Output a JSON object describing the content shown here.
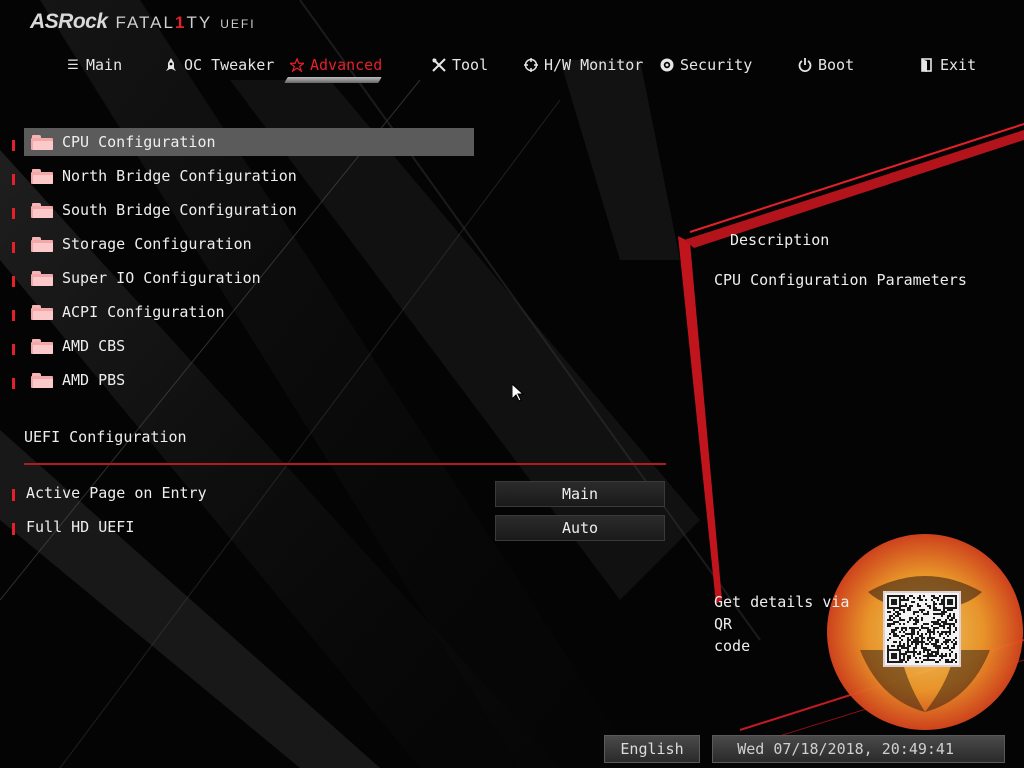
{
  "brand": {
    "name": "ASRock",
    "series_prefix": "FATAL",
    "series_one": "1",
    "series_suffix": "TY",
    "firmware": "UEFI"
  },
  "nav": {
    "tabs": [
      {
        "label": "Main",
        "icon": "list-icon"
      },
      {
        "label": "OC Tweaker",
        "icon": "rocket-icon"
      },
      {
        "label": "Advanced",
        "icon": "star-icon",
        "active": true
      },
      {
        "label": "Tool",
        "icon": "tools-icon"
      },
      {
        "label": "H/W Monitor",
        "icon": "crosshair-icon"
      },
      {
        "label": "Security",
        "icon": "shield-icon"
      },
      {
        "label": "Boot",
        "icon": "power-icon"
      },
      {
        "label": "Exit",
        "icon": "exit-icon"
      }
    ]
  },
  "menu": {
    "items": [
      {
        "label": "CPU Configuration",
        "selected": true
      },
      {
        "label": "North Bridge Configuration"
      },
      {
        "label": "South Bridge Configuration"
      },
      {
        "label": "Storage Configuration"
      },
      {
        "label": "Super IO Configuration"
      },
      {
        "label": "ACPI Configuration"
      },
      {
        "label": "AMD CBS"
      },
      {
        "label": "AMD PBS"
      }
    ]
  },
  "uefi_config": {
    "title": "UEFI Configuration",
    "settings": [
      {
        "label": "Active Page on Entry",
        "value": "Main"
      },
      {
        "label": "Full HD UEFI",
        "value": "Auto"
      }
    ]
  },
  "description": {
    "title": "Description",
    "text": "CPU Configuration Parameters",
    "qr_line1": "Get details via QR",
    "qr_line2": "code"
  },
  "footer": {
    "language": "English",
    "datetime": "Wed 07/18/2018, 20:49:41"
  },
  "colors": {
    "accent": "#e4202a",
    "selected_row": "#5b5b5b",
    "folder": "#f4a7a9"
  }
}
